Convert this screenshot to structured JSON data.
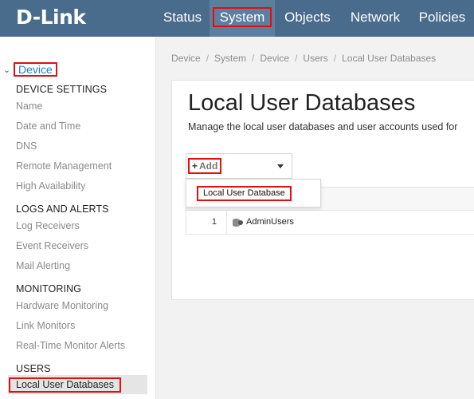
{
  "brand": {
    "logo_text": "D-Link"
  },
  "topnav": {
    "items": [
      {
        "label": "Status"
      },
      {
        "label": "System"
      },
      {
        "label": "Objects"
      },
      {
        "label": "Network"
      },
      {
        "label": "Policies"
      }
    ],
    "active": "System"
  },
  "sidebar": {
    "root_label": "Device",
    "sections": [
      {
        "title": "DEVICE SETTINGS",
        "items": [
          "Name",
          "Date and Time",
          "DNS",
          "Remote Management",
          "High Availability"
        ]
      },
      {
        "title": "LOGS AND ALERTS",
        "items": [
          "Log Receivers",
          "Event Receivers",
          "Mail Alerting"
        ]
      },
      {
        "title": "MONITORING",
        "items": [
          "Hardware Monitoring",
          "Link Monitors",
          "Real-Time Monitor Alerts"
        ]
      },
      {
        "title": "USERS",
        "items": [
          "Local User Databases"
        ]
      }
    ],
    "active_item": "Local User Databases"
  },
  "breadcrumb": [
    "Device",
    "System",
    "Device",
    "Users",
    "Local User Databases"
  ],
  "breadcrumb_sep": "/",
  "page": {
    "title": "Local User Databases",
    "description": "Manage the local user databases and user accounts used for"
  },
  "toolbar": {
    "add_label": "Add",
    "add_icon": "plus-icon"
  },
  "dropdown": {
    "items": [
      "Local User Database"
    ]
  },
  "table": {
    "rows": [
      {
        "index": "1",
        "name": "AdminUsers",
        "icon": "user-database-icon"
      }
    ]
  },
  "colors": {
    "topbar": "#4a6c8c",
    "active_nav": "#5d7f9e",
    "link": "#2a7cc7",
    "highlight_box": "#e01010"
  }
}
